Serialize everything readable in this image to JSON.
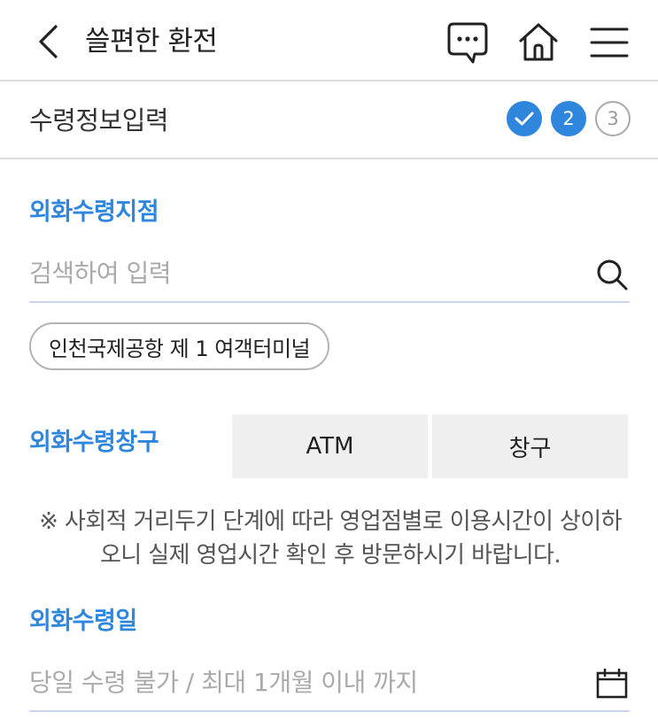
{
  "header": {
    "title": "쓸편한 환전",
    "back_icon": "chevron-left-icon",
    "chat_icon": "chat-icon",
    "home_icon": "home-icon",
    "menu_icon": "hamburger-menu-icon"
  },
  "step_bar": {
    "title": "수령정보입력",
    "steps": [
      {
        "label": "",
        "state": "done"
      },
      {
        "label": "2",
        "state": "active"
      },
      {
        "label": "3",
        "state": "pending"
      }
    ]
  },
  "branch": {
    "label": "외화수령지점",
    "placeholder": "검색하여 입력",
    "selected_chip": "인천국제공항 제 1 여객터미널",
    "icon": "search-icon"
  },
  "counter": {
    "label": "외화수령창구",
    "options": [
      "ATM",
      "창구"
    ]
  },
  "notice": "※ 사회적 거리두기 단계에 따라 영업점별로 이용시간이 상이하오니 실제 영업시간 확인 후 방문하시기 바랍니다.",
  "date": {
    "label": "외화수령일",
    "placeholder": "당일 수령 불가 / 최대 1개월 이내 까지",
    "icon": "calendar-icon"
  },
  "colors": {
    "accent": "#2f86dd",
    "divider": "#dcdcdc",
    "field_underline": "#c9d6ee",
    "segment_bg": "#efefef"
  }
}
